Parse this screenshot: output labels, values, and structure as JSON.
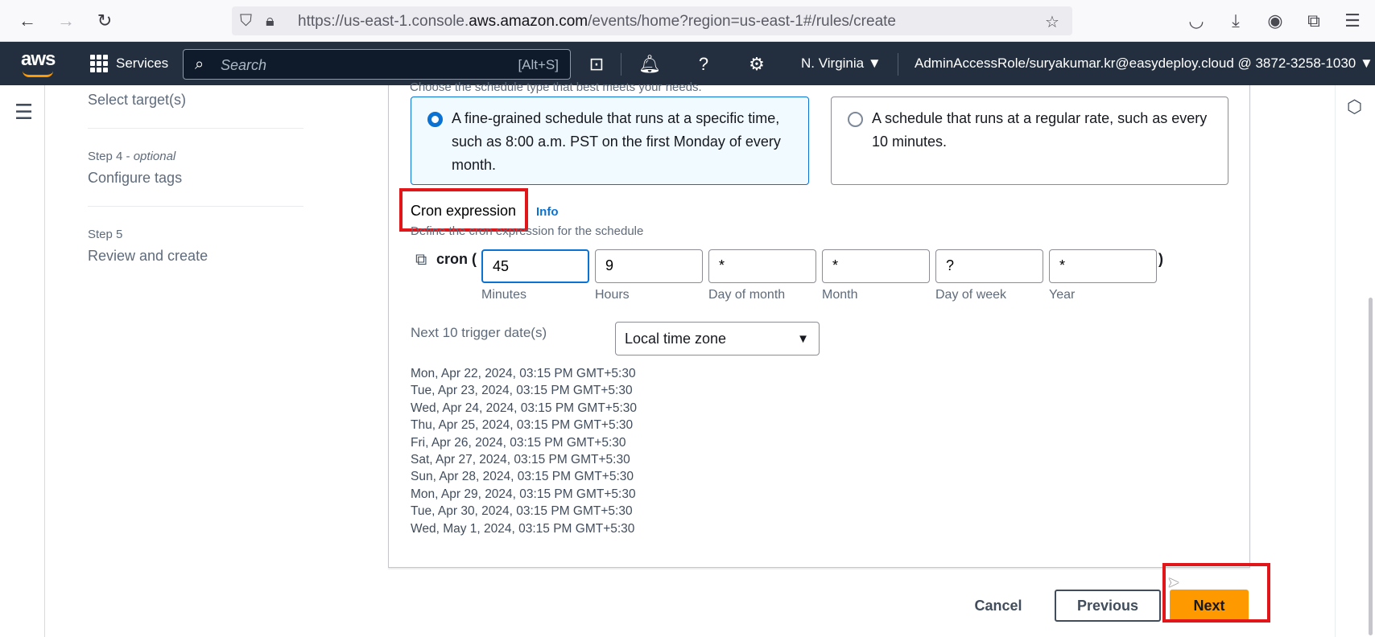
{
  "browser": {
    "url_prefix": "https://us-east-1.console.",
    "url_host": "aws.amazon.com",
    "url_suffix": "/events/home?region=us-east-1#/rules/create"
  },
  "aws_header": {
    "logo": "aws",
    "services_label": "Services",
    "search_placeholder": "Search",
    "search_shortcut": "[Alt+S]",
    "region": "N. Virginia ▼",
    "account": "AdminAccessRole/suryakumar.kr@easydeploy.cloud @ 3872-3258-1030 ▼"
  },
  "steps": [
    {
      "caption": "",
      "title": "Select target(s)"
    },
    {
      "caption": "Step 4",
      "optional": "optional",
      "title": "Configure tags"
    },
    {
      "caption": "Step 5",
      "title": "Review and create"
    }
  ],
  "schedule": {
    "cut_text": "Choose the schedule type that best meets your needs.",
    "option_fine": "A fine-grained schedule that runs at a specific time, such as 8:00 a.m. PST on the first Monday of every month.",
    "option_rate": "A schedule that runs at a regular rate, such as every 10 minutes."
  },
  "cron": {
    "label": "Cron expression",
    "info": "Info",
    "description": "Define the cron expression for the schedule",
    "prefix": "cron (",
    "suffix": ")",
    "fields": [
      {
        "label": "Minutes",
        "value": "45"
      },
      {
        "label": "Hours",
        "value": "9"
      },
      {
        "label": "Day of month",
        "value": "*"
      },
      {
        "label": "Month",
        "value": "*"
      },
      {
        "label": "Day of week",
        "value": "?"
      },
      {
        "label": "Year",
        "value": "*"
      }
    ]
  },
  "triggers": {
    "label": "Next 10 trigger date(s)",
    "timezone": "Local time zone",
    "dates": [
      "Mon, Apr 22, 2024, 03:15 PM GMT+5:30",
      "Tue, Apr 23, 2024, 03:15 PM GMT+5:30",
      "Wed, Apr 24, 2024, 03:15 PM GMT+5:30",
      "Thu, Apr 25, 2024, 03:15 PM GMT+5:30",
      "Fri, Apr 26, 2024, 03:15 PM GMT+5:30",
      "Sat, Apr 27, 2024, 03:15 PM GMT+5:30",
      "Sun, Apr 28, 2024, 03:15 PM GMT+5:30",
      "Mon, Apr 29, 2024, 03:15 PM GMT+5:30",
      "Tue, Apr 30, 2024, 03:15 PM GMT+5:30",
      "Wed, May 1, 2024, 03:15 PM GMT+5:30"
    ]
  },
  "actions": {
    "cancel": "Cancel",
    "previous": "Previous",
    "next": "Next"
  },
  "colors": {
    "aws_nav": "#232f3e",
    "accent": "#0972d3",
    "primary_button": "#ff9900",
    "highlight_box": "#e0161b"
  }
}
